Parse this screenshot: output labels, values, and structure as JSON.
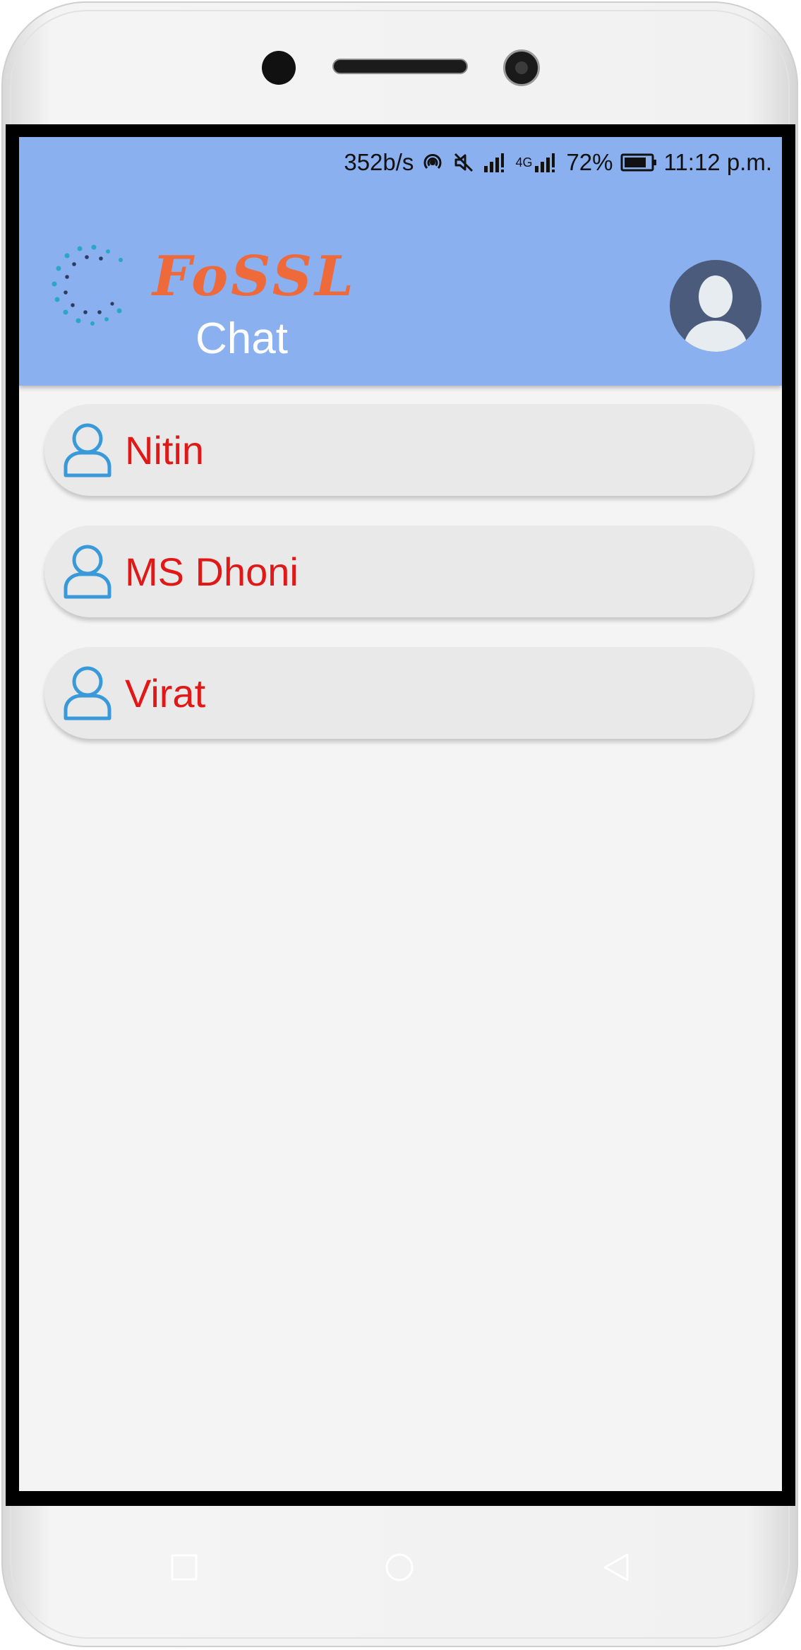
{
  "status_bar": {
    "network_speed": "352b/s",
    "network_type": "4G",
    "battery_percent": "72%",
    "time": "11:12 p.m.",
    "icons": [
      "hotspot-icon",
      "mute-icon",
      "signal-icon",
      "signal-4g-icon",
      "battery-icon"
    ]
  },
  "header": {
    "logo_word": "FoSSL",
    "logo_subtitle": "Chat",
    "profile_icon": "user-avatar-icon",
    "colors": {
      "appbar": "#8ab0f0",
      "logo_orange": "#ef6a3b"
    }
  },
  "contacts": [
    {
      "name": "Nitin",
      "icon": "user-outline-icon"
    },
    {
      "name": "MS Dhoni",
      "icon": "user-outline-icon"
    },
    {
      "name": "Virat",
      "icon": "user-outline-icon"
    }
  ],
  "contact_name_color": "#e11818",
  "nav_bar": {
    "buttons": [
      "recents-square-icon",
      "home-circle-icon",
      "back-triangle-icon"
    ]
  }
}
